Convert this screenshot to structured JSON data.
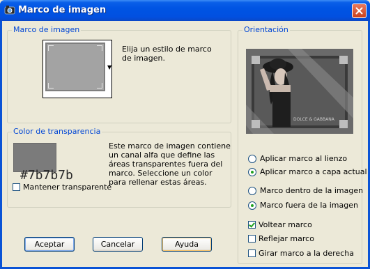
{
  "window": {
    "title": "Marco de imagen"
  },
  "frame_group": {
    "title": "Marco de imagen",
    "description": "Elija un estilo de marco de imagen."
  },
  "transparency_group": {
    "title": "Color de transparencia",
    "description": "Este marco de imagen contiene un canal alfa que define las áreas transparentes fuera del marco. Seleccione un color para rellenar estas áreas.",
    "color_hex": "#7b7b7b",
    "keep_transparent_label": "Mantener transparente",
    "keep_transparent_checked": false
  },
  "orientation_group": {
    "title": "Orientación",
    "preview_watermark": "DOLCE & GABBANA",
    "apply_options": [
      {
        "label": "Aplicar marco al lienzo",
        "checked": false
      },
      {
        "label": "Aplicar marco a capa actual",
        "checked": true
      }
    ],
    "position_options": [
      {
        "label": "Marco dentro de la imagen",
        "checked": false
      },
      {
        "label": "Marco fuera de la imagen",
        "checked": true
      }
    ],
    "checkboxes": [
      {
        "label": "Voltear marco",
        "checked": true
      },
      {
        "label": "Reflejar marco",
        "checked": false
      },
      {
        "label": "Girar marco a la derecha",
        "checked": false
      }
    ]
  },
  "buttons": {
    "ok": "Aceptar",
    "cancel": "Cancelar",
    "help": "Ayuda"
  },
  "colors": {
    "titlebar": "#0054e3",
    "dialog_bg": "#ece9d8",
    "group_title": "#0046d5",
    "check_green": "#21a121"
  }
}
